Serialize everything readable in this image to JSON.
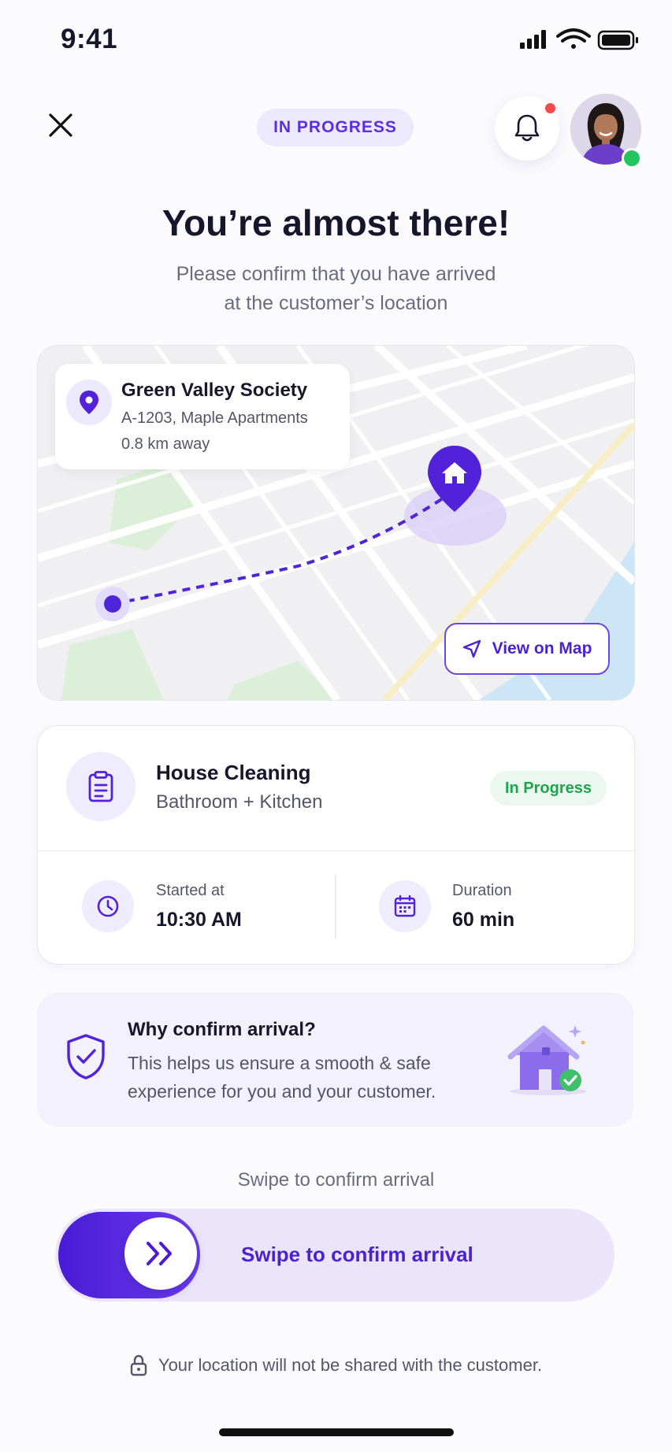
{
  "status_bar": {
    "time": "9:41"
  },
  "header": {
    "badge": "IN PROGRESS",
    "close_icon": "close-icon",
    "bell_icon": "bell-icon",
    "has_notification": true
  },
  "hero": {
    "title": "You’re almost there!",
    "subtitle_line1": "Please confirm that you have arrived",
    "subtitle_line2": "at the customer’s location"
  },
  "map": {
    "place_name": "Green Valley Society",
    "address": "A-1203, Maple Apartments",
    "distance": "0.8 km away",
    "view_button": "View on Map"
  },
  "task": {
    "title": "House Cleaning",
    "subtitle": "Bathroom + Kitchen",
    "status": "In Progress",
    "started_label": "Started at",
    "started_value": "10:30 AM",
    "duration_label": "Duration",
    "duration_value": "60 min"
  },
  "why": {
    "title": "Why confirm arrival?",
    "text": "This helps us ensure a smooth & safe experience for you and your customer."
  },
  "swipe": {
    "hint": "Swipe to confirm arrival",
    "label": "Swipe to confirm arrival"
  },
  "privacy": {
    "text": "Your location will not be shared with the customer."
  },
  "colors": {
    "accent": "#5b2fe0",
    "accent_light": "#ece8fd",
    "success": "#1da54d",
    "danger": "#f24a4a"
  }
}
